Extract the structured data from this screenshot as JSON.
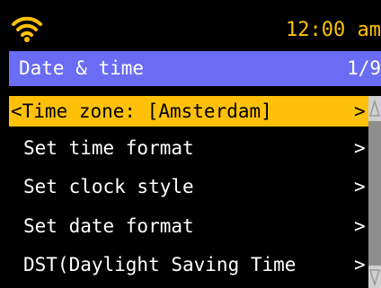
{
  "status_bar": {
    "wifi_icon": "wifi-icon",
    "time": "12:00 am"
  },
  "header": {
    "title": "Date & time",
    "page_indicator": "1/9"
  },
  "menu": {
    "items": [
      {
        "label": "<Time zone: [Amsterdam]",
        "chevron": ">"
      },
      {
        "label": "Set time format",
        "chevron": ">"
      },
      {
        "label": "Set clock style",
        "chevron": ">"
      },
      {
        "label": "Set date format",
        "chevron": ">"
      },
      {
        "label": "DST(Daylight Saving Time",
        "chevron": ">"
      }
    ],
    "selected_index": 0
  },
  "colors": {
    "accent": "#FFC107",
    "header_bg": "#6A6CF3",
    "background": "#000000",
    "text": "#FFFFFF",
    "scrollbar_track": "#CFCFCF",
    "scrollbar_thumb": "#8E8E8E"
  }
}
